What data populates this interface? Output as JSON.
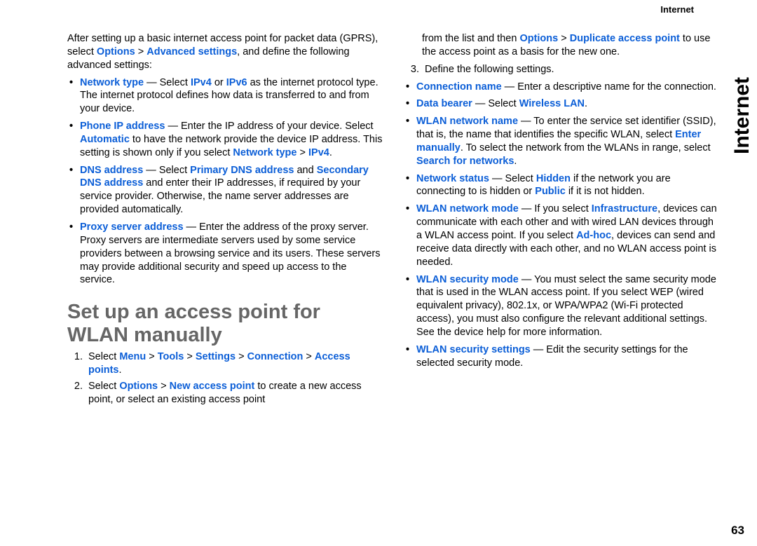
{
  "header": {
    "topic": "Internet"
  },
  "side_tab": "Internet",
  "page_number": "63",
  "left": {
    "intro_before": "After setting up a basic internet access point for packet data (GPRS), select ",
    "intro_link1": "Options",
    "intro_gt1": " > ",
    "intro_link2": "Advanced settings",
    "intro_after": ", and define the following advanced settings:",
    "bullets": {
      "net_type": {
        "label": "Network type",
        "dash": " — Select ",
        "ipv4": "IPv4",
        "or": " or ",
        "ipv6": "IPv6",
        "rest": " as the internet protocol type. The internet protocol defines how data is transferred to and from your device."
      },
      "phone_ip": {
        "label": "Phone IP address",
        "dash": " — Enter the IP address of your device. Select ",
        "auto": "Automatic",
        "mid": " to have the network provide the device IP address. This setting is shown only if you select ",
        "ntype": "Network type",
        "gt": " > ",
        "ipv4b": "IPv4",
        "end": "."
      },
      "dns": {
        "label": "DNS address",
        "dash": " — Select ",
        "primary": "Primary DNS address",
        "and": " and ",
        "secondary": "Secondary DNS address",
        "rest": " and enter their IP addresses, if required by your service provider. Otherwise, the name server addresses are provided automatically."
      },
      "proxy": {
        "label": "Proxy server address",
        "rest": " — Enter the address of the proxy server. Proxy servers are intermediate servers used by some service providers between a browsing service and its users. These servers may provide additional security and speed up access to the service."
      }
    },
    "section_title": "Set up an access point for WLAN manually",
    "steps": {
      "s1_pre": "Select ",
      "s1_menu": "Menu",
      "gt1": " > ",
      "s1_tools": "Tools",
      "gt2": " > ",
      "s1_settings": "Settings",
      "gt3": " > ",
      "s1_conn": "Connection",
      "gt4": " > ",
      "s1_ap": "Access points",
      "s1_end": ".",
      "s2_pre": "Select ",
      "s2_opt": "Options",
      "gt5": " > ",
      "s2_new": "New access point",
      "s2_rest": " to create a new access point, or select an existing access point"
    }
  },
  "right": {
    "cont_pre": "from the list and then ",
    "cont_opt": "Options",
    "cont_gt": " > ",
    "cont_dup": "Duplicate access point",
    "cont_rest": " to use the access point as a basis for the new one.",
    "step3": "Define the following settings.",
    "bullets": {
      "conn": {
        "label": "Connection name",
        "rest": " — Enter a descriptive name for the connection."
      },
      "bearer": {
        "label": "Data bearer",
        "dash": " — Select ",
        "wlan": "Wireless LAN",
        "end": "."
      },
      "wname": {
        "label": "WLAN network name",
        "pre": " — To enter the service set identifier (SSID), that is, the name that identifies the specific WLAN, select ",
        "enter": "Enter manually",
        "mid": ". To select the network from the WLANs in range, select ",
        "search": "Search for networks",
        "end": "."
      },
      "nstatus": {
        "label": "Network status",
        "dash": " — Select ",
        "hidden": "Hidden",
        "mid": " if the network you are connecting to is hidden or ",
        "public": "Public",
        "rest": " if it is not hidden."
      },
      "wmode": {
        "label": "WLAN network mode",
        "pre": " — If you select ",
        "infra": "Infrastructure",
        "mid1": ", devices can communicate with each other and with wired LAN devices through a WLAN access point. If you select ",
        "adhoc": "Ad-hoc",
        "rest": ", devices can send and receive data directly with each other, and no WLAN access point is needed."
      },
      "wsec": {
        "label": "WLAN security mode",
        "rest": " — You must select the same security mode that is used in the WLAN access point. If you select WEP (wired equivalent privacy), 802.1x, or WPA/WPA2 (Wi-Fi protected access), you must also configure the relevant additional settings. See the device help for more information."
      },
      "wset": {
        "label": "WLAN security settings",
        "rest": " — Edit the security settings for the selected security mode."
      }
    }
  }
}
